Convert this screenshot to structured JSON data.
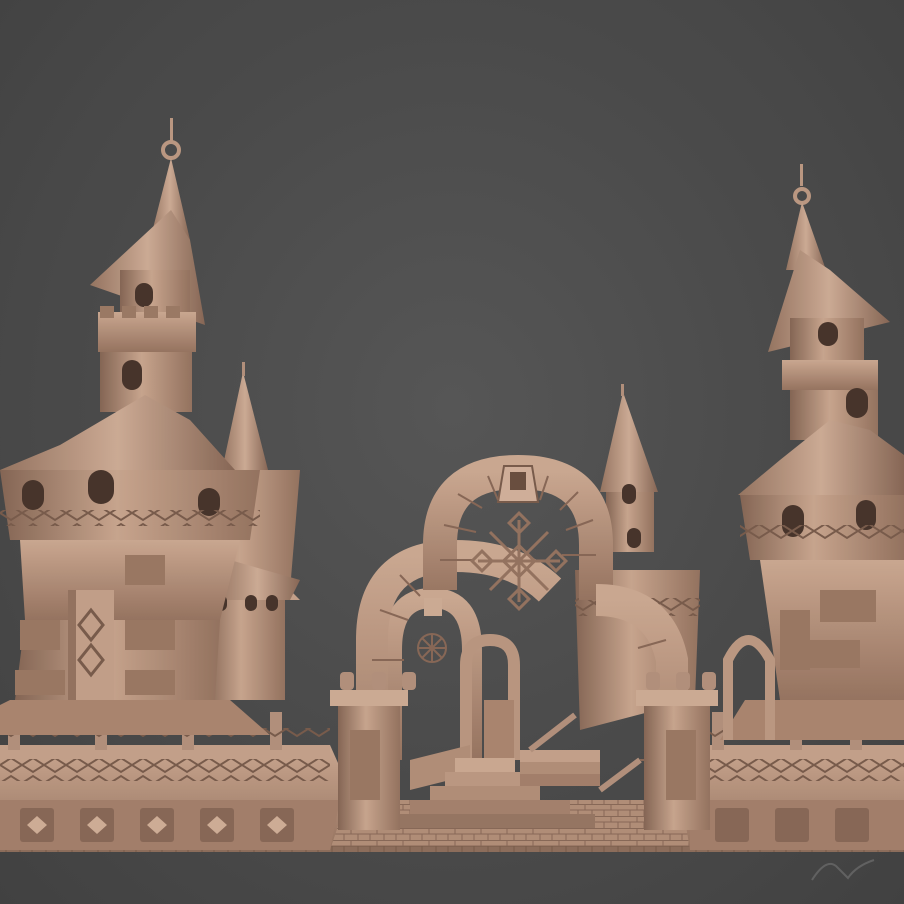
{
  "scene": {
    "subject": "castle-towers-with-stone-arches",
    "colors": {
      "background": "#4e4e4e",
      "stone_light": "#c9a48c",
      "stone_mid": "#b08a73",
      "stone_dark": "#7d5f4f",
      "shadow": "#5e4639"
    }
  },
  "signature": {
    "text": "N",
    "kind": "artist-logo"
  }
}
